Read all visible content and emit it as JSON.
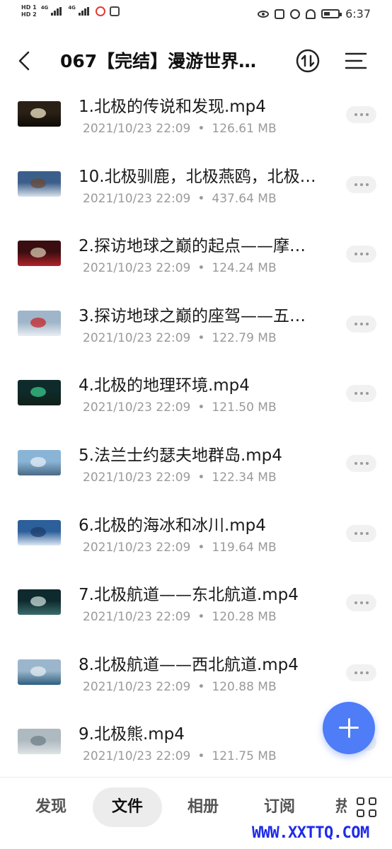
{
  "status_bar": {
    "hd1": "HD 1",
    "hd2": "HD 2",
    "net1": "4G",
    "net2": "4G",
    "time": "6:37"
  },
  "header": {
    "title": "067【完结】漫游世界…"
  },
  "files": [
    {
      "name": "1.北极的传说和发现.mp4",
      "date": "2021/10/23 22:09",
      "size": "126.61 MB",
      "thumb": {
        "sky": "#2a2015",
        "ground": "#0d0a05",
        "accent": "#f0e6c8"
      }
    },
    {
      "name": "10.北极驯鹿，北极燕鸥，北极…",
      "date": "2021/10/23 22:09",
      "size": "437.64 MB",
      "thumb": {
        "sky": "#3b5f8a",
        "ground": "#d9e1ea",
        "accent": "#6b4a35"
      }
    },
    {
      "name": "2.探访地球之巅的起点——摩…",
      "date": "2021/10/23 22:09",
      "size": "124.24 MB",
      "thumb": {
        "sky": "#3a0d10",
        "ground": "#b0242a",
        "accent": "#d6c8b0"
      }
    },
    {
      "name": "3.探访地球之巅的座驾——五…",
      "date": "2021/10/23 22:09",
      "size": "122.79 MB",
      "thumb": {
        "sky": "#9fb5c9",
        "ground": "#e9eef3",
        "accent": "#c62828"
      }
    },
    {
      "name": "4.北极的地理环境.mp4",
      "date": "2021/10/23 22:09",
      "size": "121.50 MB",
      "thumb": {
        "sky": "#0e2a2a",
        "ground": "#102018",
        "accent": "#39c98a"
      }
    },
    {
      "name": "5.法兰士约瑟夫地群岛.mp4",
      "date": "2021/10/23 22:09",
      "size": "122.34 MB",
      "thumb": {
        "sky": "#8ab4d6",
        "ground": "#4a6a86",
        "accent": "#e6eef5"
      }
    },
    {
      "name": "6.北极的海冰和冰川.mp4",
      "date": "2021/10/23 22:09",
      "size": "119.64 MB",
      "thumb": {
        "sky": "#2d5f9a",
        "ground": "#dbe7f2",
        "accent": "#1c3e6e"
      }
    },
    {
      "name": "7.北极航道——东北航道.mp4",
      "date": "2021/10/23 22:09",
      "size": "120.28 MB",
      "thumb": {
        "sky": "#0f2a2e",
        "ground": "#3a6b6a",
        "accent": "#c9dcd8"
      }
    },
    {
      "name": "8.北极航道——西北航道.mp4",
      "date": "2021/10/23 22:09",
      "size": "120.88 MB",
      "thumb": {
        "sky": "#9bb6cc",
        "ground": "#2f5f7f",
        "accent": "#e3ecf3"
      }
    },
    {
      "name": "9.北极熊.mp4",
      "date": "2021/10/23 22:09",
      "size": "121.75 MB",
      "thumb": {
        "sky": "#aeb9c0",
        "ground": "#dfe3e4",
        "accent": "#6f7f86"
      }
    }
  ],
  "tabs": [
    {
      "label": "发现"
    },
    {
      "label": "文件"
    },
    {
      "label": "相册"
    },
    {
      "label": "订阅"
    },
    {
      "label": "热"
    }
  ],
  "watermark": "WWW.XXTTQ.COM",
  "colors": {
    "fab": "#4f7cf7",
    "watermark": "#1e2be8"
  },
  "icons": {
    "back": "back-arrow-icon",
    "sort": "sort-icon",
    "menu": "menu-icon",
    "more": "more-dots-icon",
    "add": "plus-icon",
    "grid": "grid-icon"
  }
}
